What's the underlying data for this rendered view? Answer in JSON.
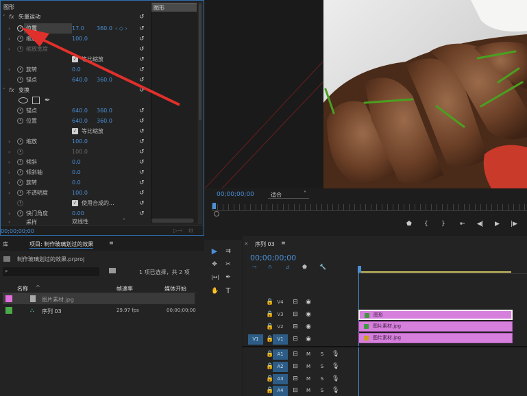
{
  "effects_panel": {
    "title": "图形",
    "timeline_clip_label": "图形",
    "time": "00;00;00;00",
    "vector_motion": {
      "label": "矢量运动",
      "fx": "fx",
      "position": {
        "label": "位置",
        "x": "17.0",
        "y": "360.0"
      },
      "scale": {
        "label": "缩放",
        "value": "100.0"
      },
      "scale_width": {
        "label": "缩放宽度"
      },
      "uniform_scale": {
        "label": "等比缩放"
      },
      "rotation": {
        "label": "旋转",
        "value": "0.0"
      },
      "anchor": {
        "label": "锚点",
        "x": "640.0",
        "y": "360.0"
      }
    },
    "transform": {
      "label": "变换",
      "fx": "fx",
      "anchor": {
        "label": "锚点",
        "x": "640.0",
        "y": "360.0"
      },
      "position": {
        "label": "位置",
        "x": "640.0",
        "y": "360.0"
      },
      "uniform_scale": {
        "label": "等比缩放"
      },
      "scale": {
        "label": "缩放",
        "value": "100.0"
      },
      "scale_width": {
        "value": "100.0"
      },
      "skew": {
        "label": "倾斜",
        "value": "0.0"
      },
      "skew_axis": {
        "label": "倾斜轴",
        "value": "0.0"
      },
      "rotation": {
        "label": "旋转",
        "value": "0.0"
      },
      "opacity": {
        "label": "不透明度",
        "value": "100.0"
      },
      "use_comp_shutter": {
        "label": "使用合成的..."
      },
      "shutter_angle": {
        "label": "快门角度",
        "value": "0.00"
      },
      "sampling": {
        "label": "采样",
        "value": "双线性"
      }
    }
  },
  "program_monitor": {
    "timecode": "00;00;00;00",
    "fit": "适合"
  },
  "project_panel": {
    "tab_library": "库",
    "tab_project": "项目: 制作玻璃划过的效果",
    "filename": "制作玻璃划过的效果.prproj",
    "selection_info": "1 项已选择，共 2 项",
    "columns": {
      "name": "名称",
      "fps": "帧速率",
      "media_start": "媒体开始"
    },
    "items": [
      {
        "name": "图片素材.jpg",
        "fps": "",
        "start": ""
      },
      {
        "name": "序列 03",
        "fps": "29.97 fps",
        "start": "00;00;00;00"
      }
    ]
  },
  "timeline": {
    "title": "序列 03",
    "timecode": "00;00;00;00",
    "video_tracks": [
      "V4",
      "V3",
      "V2",
      "V1"
    ],
    "audio_tracks": [
      "A1",
      "A2",
      "A3",
      "A4"
    ],
    "source_v1": "V1",
    "clips": {
      "v3": "图形",
      "v2": "图片素材.jpg",
      "v1": "图片素材.jpg"
    },
    "audio_m": "M",
    "audio_s": "S"
  },
  "icons": {
    "selection": "▶",
    "track_select": "⇉",
    "ripple": "✥",
    "razor": "✂",
    "slip": "|↔|",
    "pen": "✒",
    "hand": "✋",
    "type": "T"
  }
}
